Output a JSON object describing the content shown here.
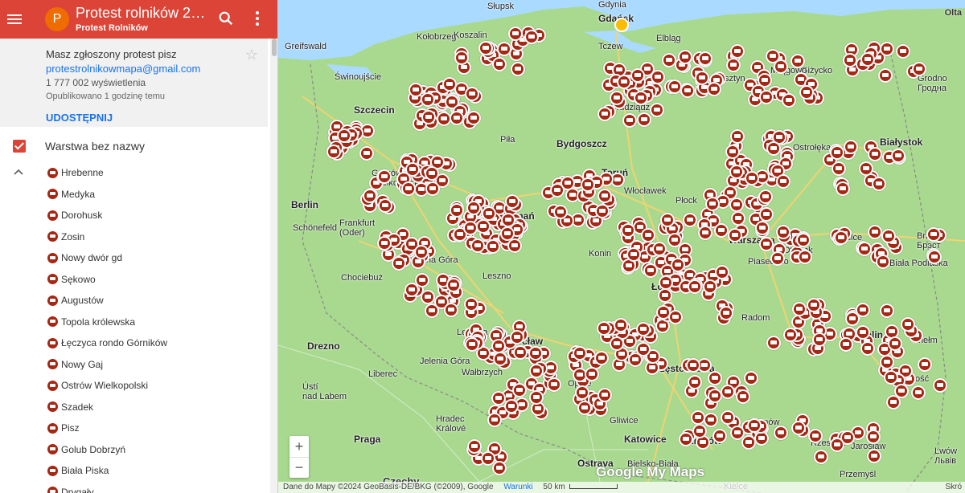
{
  "header": {
    "avatar_letter": "P",
    "title": "Protest rolników 20.0...",
    "subtitle": "Protest Rolników",
    "menu_icon": "menu-icon",
    "search_icon": "search-icon",
    "more_icon": "more-vert-icon",
    "bar_color": "#db4437"
  },
  "info": {
    "notice": "Masz zgłoszony protest pisz",
    "email": "protestrolnikowmapa@gmail.com",
    "views": "1 777 002 wyświetlenia",
    "published": "Opublikowano 1 godzinę temu",
    "share_label": "UDOSTĘPNIJ",
    "star": "☆"
  },
  "layer": {
    "name": "Warstwa bez nazwy",
    "checked": true,
    "items": [
      "Hrebenne",
      "Medyka",
      "Dorohusk",
      "Zosin",
      "Nowy dwór gd",
      "Sękowo",
      "Augustów",
      "Topola królewska",
      "Łęczyca rondo Górników",
      "Nowy Gaj",
      "Ostrów Wielkopolski",
      "Szadek",
      "Pisz",
      "Golub Dobrzyń",
      "Biała Piska",
      "Drygały"
    ],
    "marker_color": "#a52714"
  },
  "map": {
    "labels": {
      "slupsk": "Słupsk",
      "gdansk": "Gdańsk",
      "gdynia": "Gdynia",
      "kolobrzeg": "Kołobrzeg",
      "koszalin": "Koszalin",
      "tczew": "Tczew",
      "elblag": "Elbląg",
      "gizycko": "Giżycko",
      "greifswald": "Greifswald",
      "swinoujscie": "Świnoujście",
      "mragowo": "Mrągowo",
      "olsztyn": "Olsztyn",
      "grodno": "Grodno\nГродна",
      "szczecin": "Szczecin",
      "grudziadz": "Grudziądz",
      "bialystok": "Białystok",
      "bydgoszcz": "Bydgoszcz",
      "pila": "Piła",
      "ostroleka": "Ostrołęka",
      "gorzow": "Gorzów\nWielkopolski",
      "torun": "Toruń",
      "wloclawek": "Włocławek",
      "plock": "Płock",
      "berlin": "Berlin",
      "poznan": "Poznań",
      "frankfurt": "Frankfurt\n(Oder)",
      "warszawa": "Warszawa",
      "siedlce": "Siedlce",
      "brzesc": "Brześć\nБрэст",
      "schonefeld": "Schönefeld",
      "konin": "Konin",
      "otwock": "Otwock",
      "zielona": "Zielona Góra",
      "piaseczno": "Piaseczno",
      "biala": "Biała Podlaska",
      "chociebuz": "Chociebuż",
      "leszno": "Leszno",
      "radom": "Radom",
      "lodz": "Łódź",
      "lublin": "Lublin",
      "chelm": "Chełm",
      "legnica": "Legnica",
      "drezno": "Drezno",
      "wroclaw": "Wrocław",
      "jelenia": "Jelenia Góra",
      "walbrzych": "Wałbrzych",
      "opole": "Opole",
      "czestochowa": "Częstochowa",
      "liberec": "Liberec",
      "zamosc": "Zamość",
      "usti": "Ústí\nnad Labem",
      "hradec": "Hradec\nKrálové",
      "gliwice": "Gliwice",
      "katowice": "Katowice",
      "krakow": "Kraków",
      "tarnow": "Tarnów",
      "rzeszow": "Rzeszów",
      "jaroslaw": "Jarosław",
      "lwow": "Lwów\nЛьвів",
      "praga": "Praga",
      "przemysl": "Przemyśl",
      "ostrava": "Ostrava",
      "bielsko": "Bielsko-Biała",
      "czechy": "Czechy",
      "kielce": "Kielce",
      "sielce": "Siel",
      "zelazowa": "Żel",
      "ow": "ów",
      "nowy_sacz": "Nowy"
    },
    "corner_label": "Olta",
    "zoom_in": "+",
    "zoom_out": "−",
    "attribution": "Dane do Mapy ©2024 GeoBasis-DE/BKG (©2009), Google",
    "terms": "Warunki",
    "scale": "50 km",
    "short": "Skró",
    "branding": "Google My Maps",
    "water_color": "#aadaff",
    "land_color": "#a8d98f"
  }
}
